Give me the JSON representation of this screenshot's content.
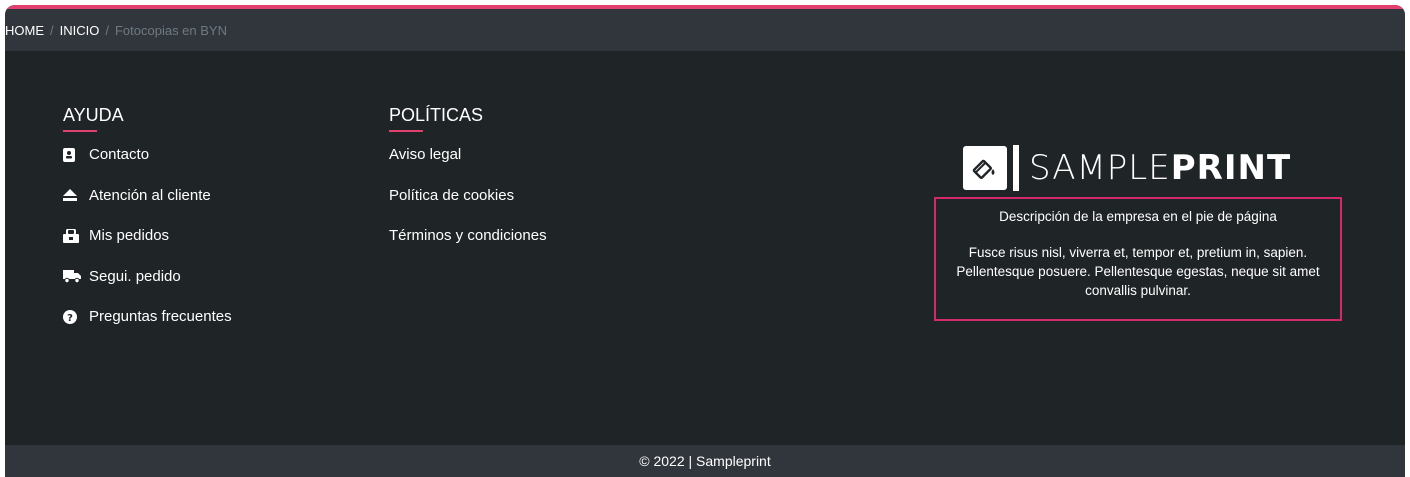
{
  "breadcrumb": {
    "items": [
      "HOME",
      "INICIO",
      "Fotocopias en BYN"
    ],
    "separator": "/"
  },
  "help": {
    "title": "AYUDA",
    "items": [
      {
        "label": "Contacto",
        "icon": "contact-card-icon"
      },
      {
        "label": "Atención al cliente",
        "icon": "eject-icon"
      },
      {
        "label": "Mis pedidos",
        "icon": "shopping-bag-icon"
      },
      {
        "label": "Segui. pedido",
        "icon": "truck-icon"
      },
      {
        "label": "Preguntas frecuentes",
        "icon": "question-circle-icon"
      }
    ]
  },
  "policies": {
    "title": "POLÍTICAS",
    "items": [
      "Aviso legal",
      "Política de cookies",
      "Términos y condiciones"
    ]
  },
  "brand": {
    "logo_icon": "paint-bucket-icon",
    "name_light": "SAMPLE",
    "name_bold": "PRINT"
  },
  "description": {
    "heading": "Descripción de la empresa en el pie de página",
    "body": "Fusce risus nisl, viverra et, tempor et, pretium in, sapien. Pellentesque posuere. Pellentesque egestas, neque sit amet convallis pulvinar."
  },
  "footer": {
    "copyright": "© 2022 | Sampleprint"
  },
  "colors": {
    "accent": "#e0416e",
    "background": "#1f2427",
    "bar": "#30363c"
  }
}
